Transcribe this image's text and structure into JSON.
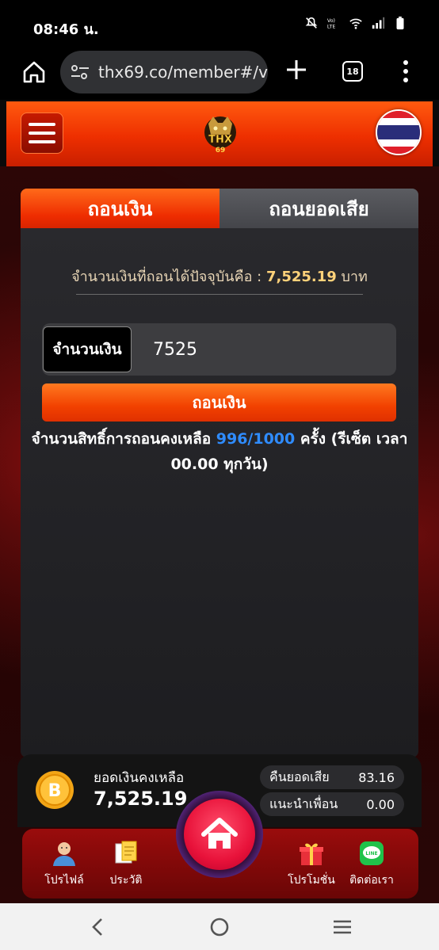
{
  "statusbar": {
    "time": "08:46 น."
  },
  "browser": {
    "url": "thx69.co/member#/v",
    "tab_count": "18"
  },
  "site": {
    "logo_text": "THX",
    "logo_sub": "69"
  },
  "tabs": [
    {
      "label": "ถอนเงิน",
      "active": true
    },
    {
      "label": "ถอนยอดเสีย",
      "active": false
    }
  ],
  "withdraw": {
    "available_prefix": "จำนวนเงินที่ถอนได้ปัจจุบันคือ : ",
    "available_amount": "7,525.19",
    "available_unit": " บาท",
    "amount_label": "จำนวนเงิน",
    "amount_value": "7525",
    "button_label": "ถอนเงิน",
    "rights_prefix": "จำนวนสิทธิ์การถอนคงเหลือ ",
    "rights_count": "996/1000",
    "rights_suffix": " ครั้ง (รีเซ็ต เวลา 00.00 ทุกวัน)"
  },
  "balance": {
    "label": "ยอดเงินคงเหลือ",
    "value": "7,525.19",
    "cashback_label": "คืนยอดเสีย",
    "cashback_value": "83.16",
    "referral_label": "แนะนำเพื่อน",
    "referral_value": "0.00"
  },
  "nav": {
    "profile": "โปรไฟล์",
    "history": "ประวัติ",
    "promotion": "โปรโมชั่น",
    "contact": "ติดต่อเรา"
  },
  "colors": {
    "accent": "#ee2f00",
    "rights_count": "#2f8cff",
    "amount": "#ffd27a"
  }
}
